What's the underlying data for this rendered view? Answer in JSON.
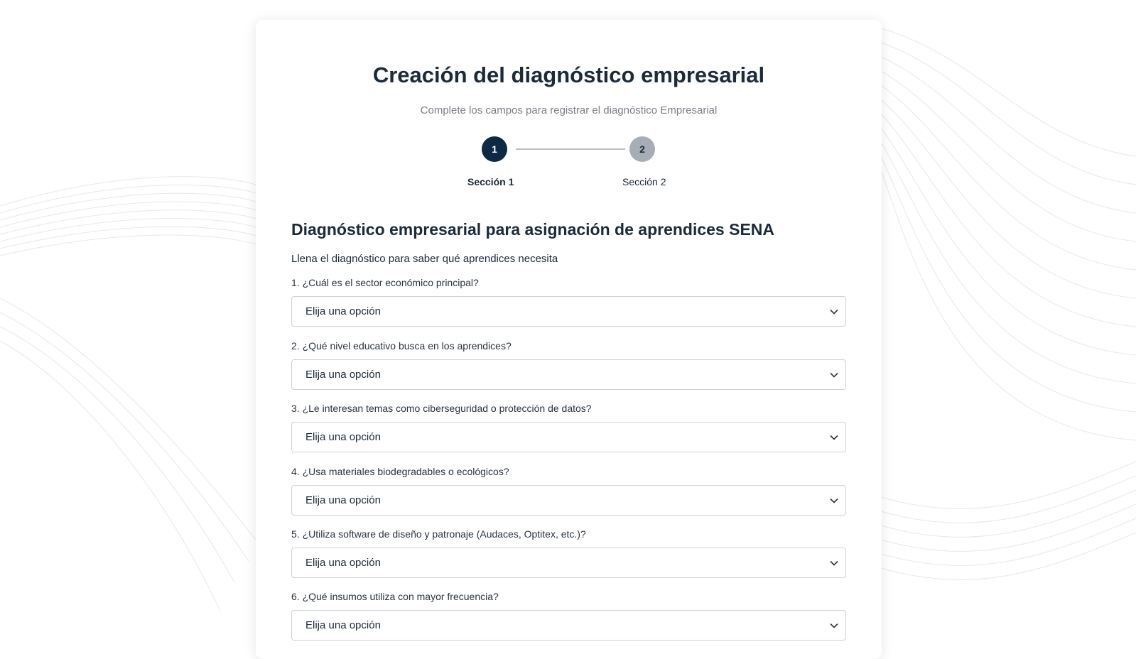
{
  "header": {
    "title": "Creación del diagnóstico empresarial",
    "subtitle": "Complete los campos para registrar el diagnóstico Empresarial"
  },
  "stepper": {
    "steps": [
      {
        "number": "1",
        "label": "Sección 1",
        "active": true
      },
      {
        "number": "2",
        "label": "Sección 2",
        "active": false
      }
    ]
  },
  "section": {
    "title": "Diagnóstico empresarial para asignación de aprendices SENA",
    "description": "Llena el diagnóstico para saber qué aprendices necesita"
  },
  "questions": [
    {
      "label": "1. ¿Cuál es el sector económico principal?",
      "value": "Elija una opción"
    },
    {
      "label": "2. ¿Qué nivel educativo busca en los aprendices?",
      "value": "Elija una opción"
    },
    {
      "label": "3. ¿Le interesan temas como ciberseguridad o protección de datos?",
      "value": "Elija una opción"
    },
    {
      "label": "4. ¿Usa materiales biodegradables o ecológicos?",
      "value": "Elija una opción"
    },
    {
      "label": "5. ¿Utiliza software de diseño y patronaje (Audaces, Optitex, etc.)?",
      "value": "Elija una opción"
    },
    {
      "label": "6. ¿Qué insumos utiliza con mayor frecuencia?",
      "value": "Elija una opción"
    }
  ],
  "colors": {
    "primary": "#0d2a45",
    "inactive_step": "#a7adb6",
    "text": "#1c2a3a",
    "muted": "#7a7f86"
  }
}
